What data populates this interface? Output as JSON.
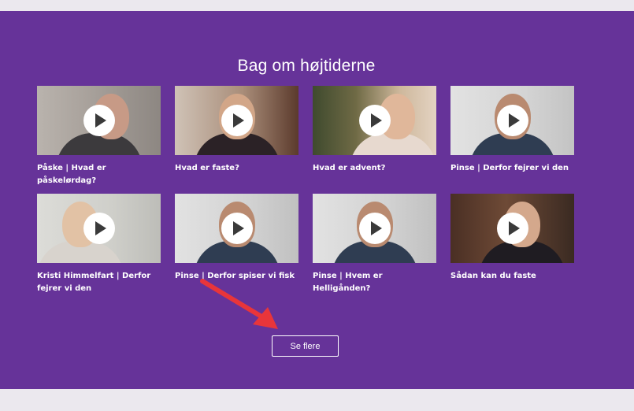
{
  "section": {
    "title": "Bag om højtiderne",
    "more_label": "Se flere"
  },
  "videos": [
    {
      "caption": "Påske | Hvad er påskelørdag?",
      "icon": "play-icon"
    },
    {
      "caption": "Hvad er faste?",
      "icon": "play-icon"
    },
    {
      "caption": "Hvad er advent?",
      "icon": "play-icon"
    },
    {
      "caption": "Pinse | Derfor fejrer vi den",
      "icon": "play-icon"
    },
    {
      "caption": "Kristi Himmelfart | Derfor fejrer vi den",
      "icon": "play-icon"
    },
    {
      "caption": "Pinse | Derfor spiser vi fisk",
      "icon": "play-icon"
    },
    {
      "caption": "Pinse | Hvem er Helligånden?",
      "icon": "play-icon"
    },
    {
      "caption": "Sådan kan du faste",
      "icon": "play-icon"
    }
  ],
  "colors": {
    "panel": "#663399",
    "page": "#ebe8ee",
    "annotation_arrow": "#e8353a"
  }
}
